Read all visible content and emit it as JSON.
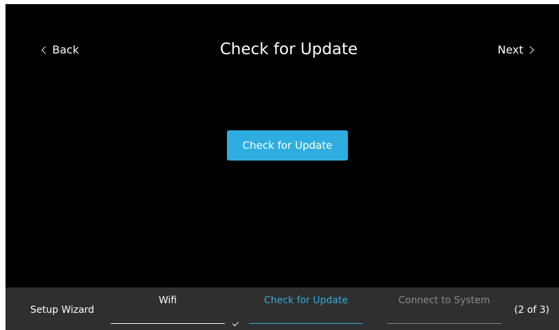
{
  "header": {
    "back_label": "Back",
    "title": "Check for Update",
    "next_label": "Next"
  },
  "main": {
    "primary_button_label": "Check for Update"
  },
  "footer": {
    "wizard_label": "Setup Wizard",
    "steps": [
      {
        "label": "Wifi",
        "state": "done"
      },
      {
        "label": "Check for Update",
        "state": "active"
      },
      {
        "label": "Connect to System",
        "state": "todo"
      }
    ],
    "counter": "(2 of 3)"
  },
  "colors": {
    "background": "#000000",
    "accent": "#2eaee0",
    "footer_bg": "#2f2f2f",
    "inactive": "#8a8a8a"
  },
  "icons": [
    "chevron-left-icon",
    "chevron-right-icon",
    "checkmark-icon"
  ]
}
